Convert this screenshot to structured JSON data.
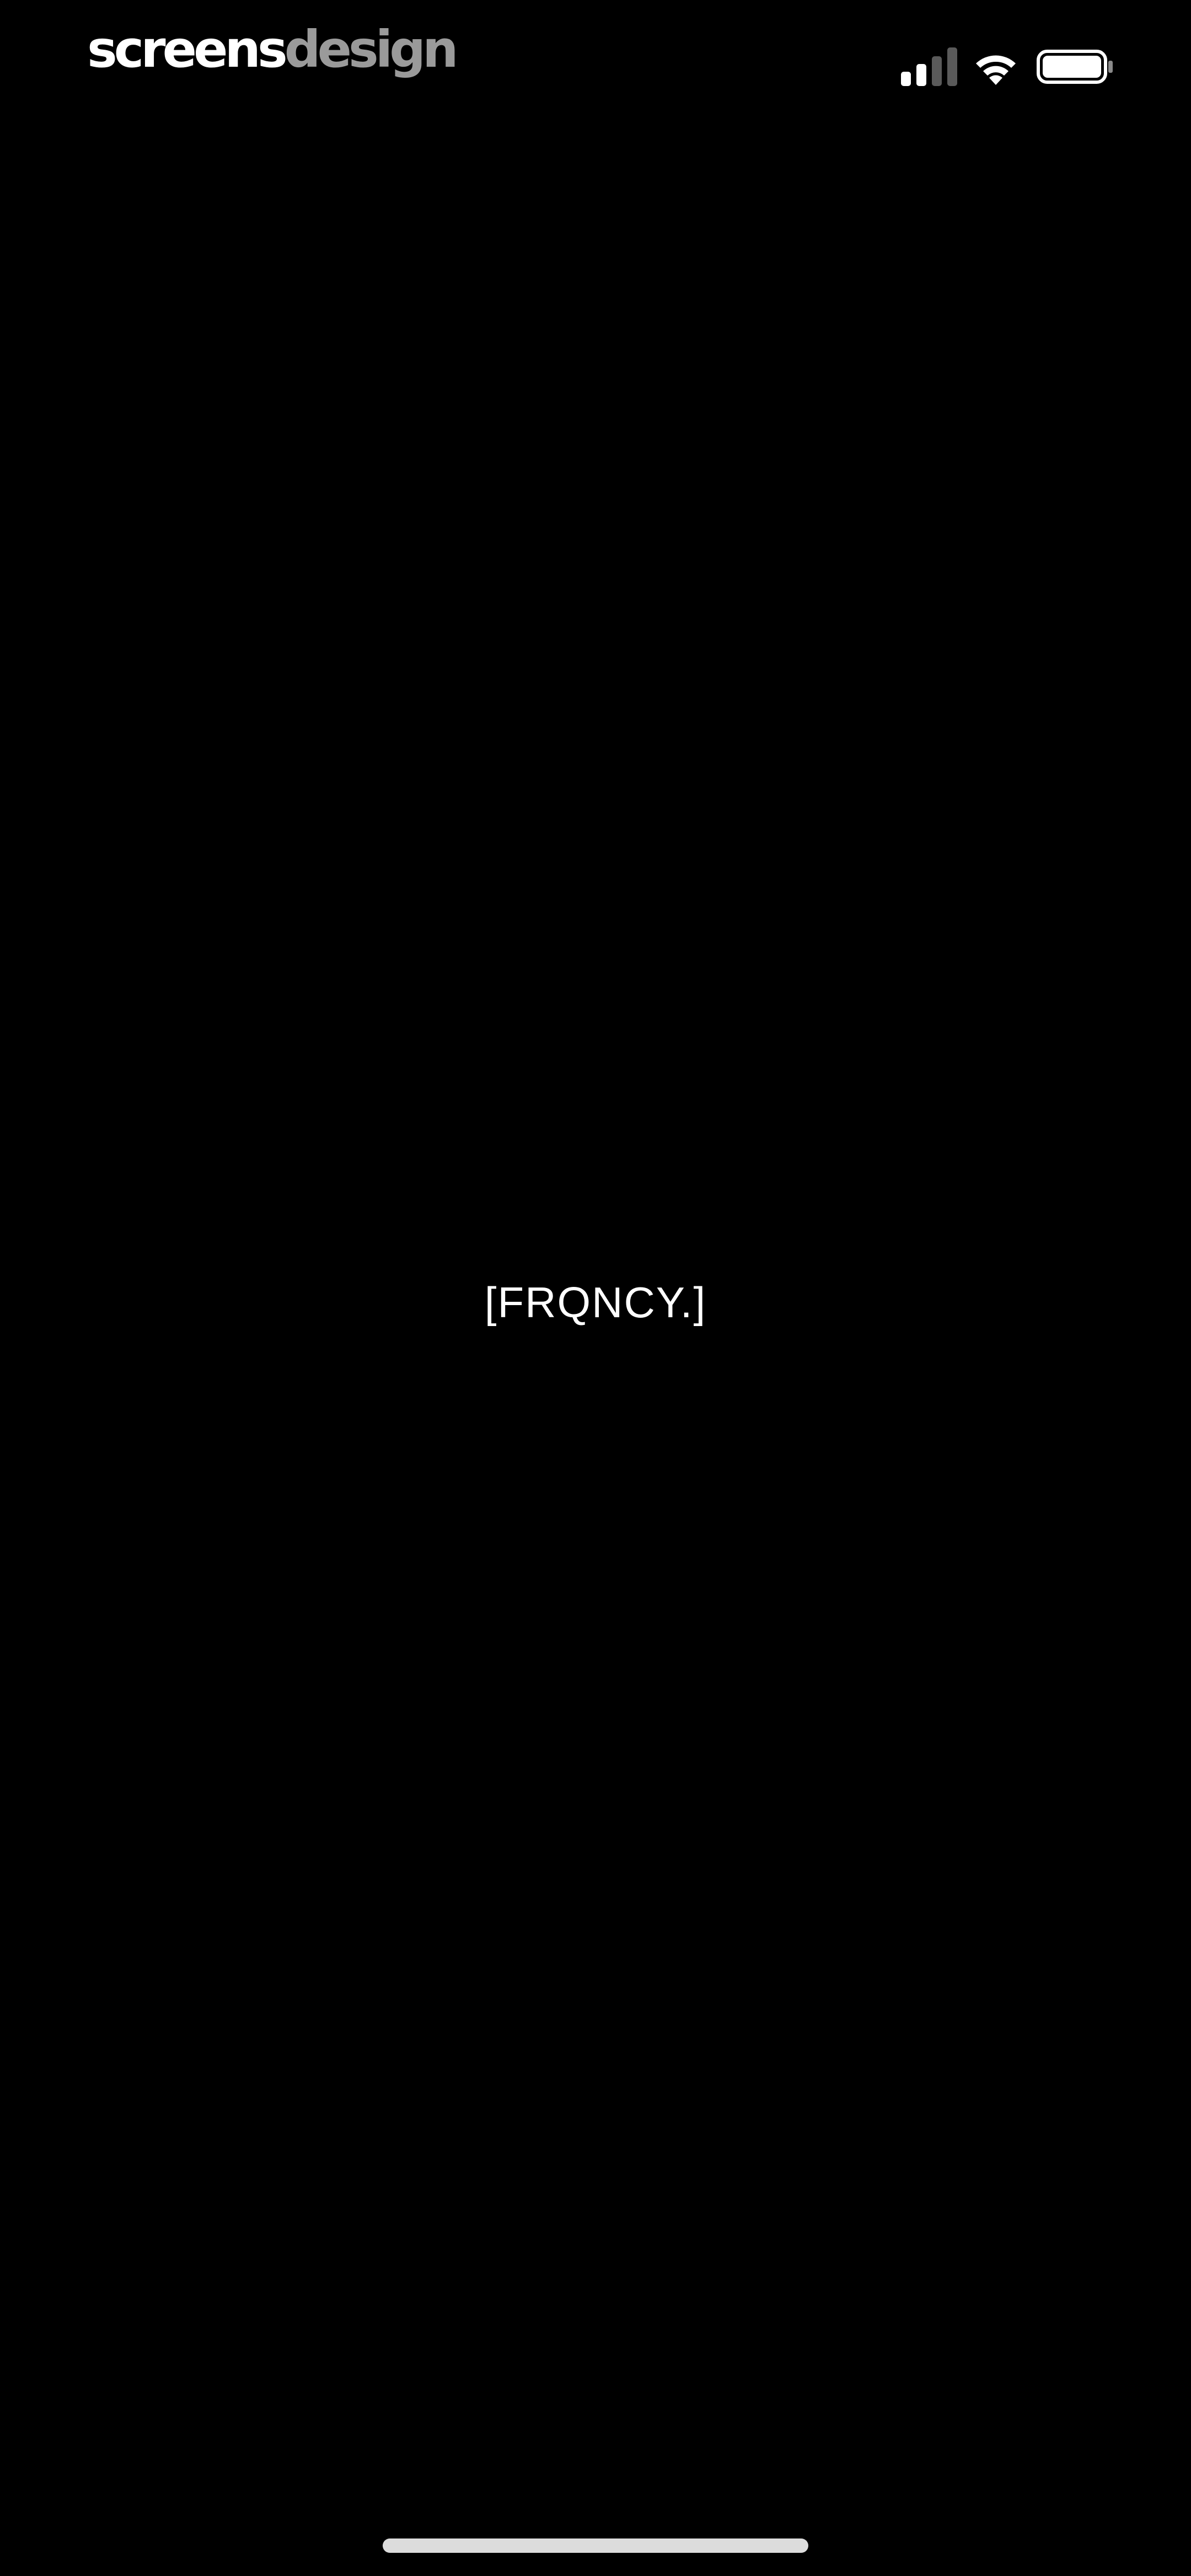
{
  "status_bar": {
    "brand": {
      "part1": "screens",
      "part2": "design"
    },
    "icons": [
      "signal-icon",
      "wifi-icon",
      "battery-icon"
    ]
  },
  "main": {
    "title": "[FRQNCY.]"
  },
  "colors": {
    "background": "#000000",
    "text": "#ffffff",
    "brand_muted": "#9a9a9a",
    "home_indicator": "#dcdcdc"
  }
}
